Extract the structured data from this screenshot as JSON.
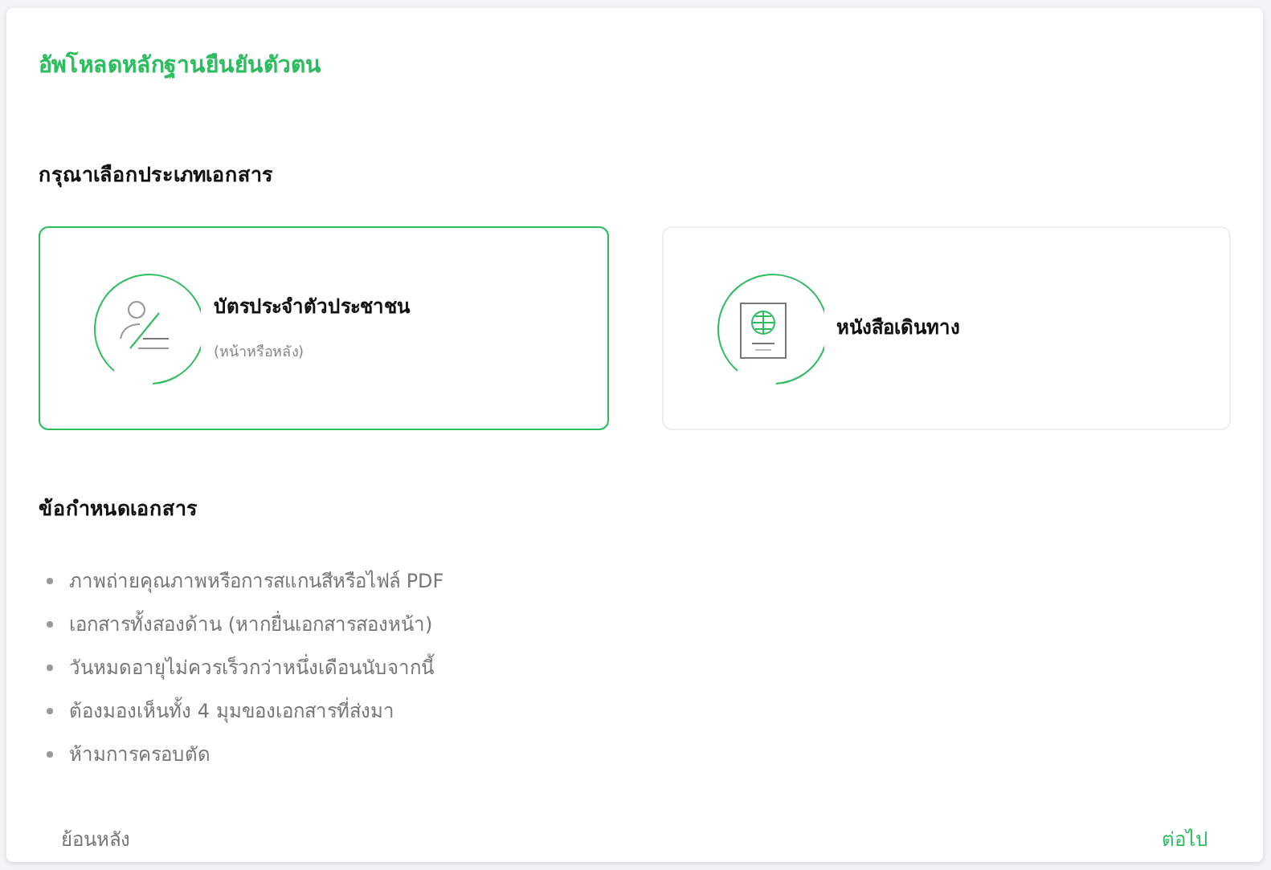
{
  "title": "อัพโหลดหลักฐานยืนยันตัวตน",
  "document_type": {
    "heading": "กรุณาเลือกประเภทเอกสาร",
    "options": [
      {
        "kind": "id-card",
        "label": "บัตรประจำตัวประชาชน",
        "note": "(หน้าหรือหลัง)",
        "selected": true
      },
      {
        "kind": "passport",
        "label": "หนังสือเดินทาง",
        "selected": false
      }
    ]
  },
  "requirements": {
    "heading": "ข้อกำหนดเอกสาร",
    "items": [
      "ภาพถ่ายคุณภาพหรือการสแกนสีหรือไฟล์ PDF",
      "เอกสารทั้งสองด้าน (หากยื่นเอกสารสองหน้า)",
      "วันหมดอายุไม่ควรเร็วกว่าหนึ่งเดือนนับจากนี้",
      "ต้องมองเห็นทั้ง 4 มุมของเอกสารที่ส่งมา",
      "ห้ามการครอบตัด"
    ]
  },
  "buttons": {
    "back": "ย้อนหลัง",
    "next": "ต่อไป"
  }
}
